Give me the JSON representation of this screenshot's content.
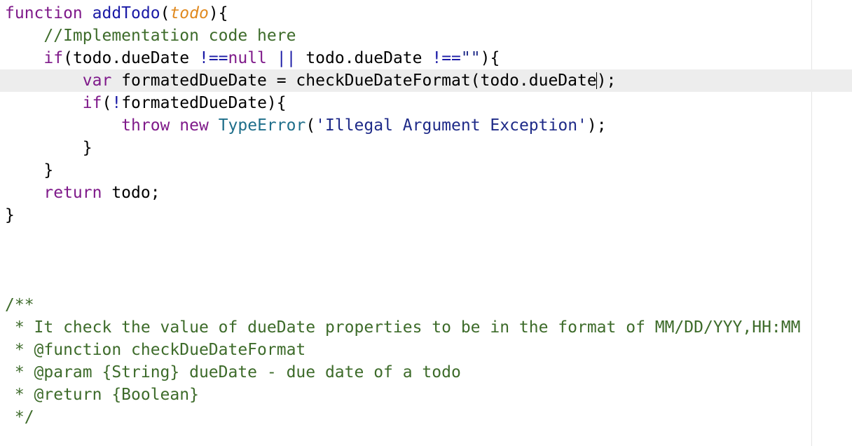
{
  "colors": {
    "keyword": "#7f1a8a",
    "function_name": "#1a1aa6",
    "parameter": "#e0891e",
    "string": "#1e2a88",
    "class": "#1e6e8a",
    "comment": "#3d6b2a",
    "current_line": "#ededed"
  },
  "editor": {
    "lines": [
      [
        {
          "t": "kw",
          "v": "function"
        },
        {
          "t": "",
          "v": " "
        },
        {
          "t": "fn",
          "v": "addTodo"
        },
        {
          "t": "",
          "v": "("
        },
        {
          "t": "param",
          "v": "todo"
        },
        {
          "t": "",
          "v": "){"
        }
      ],
      [
        {
          "t": "",
          "v": "    "
        },
        {
          "t": "cmt",
          "v": "//Implementation code here"
        }
      ],
      [
        {
          "t": "",
          "v": "    "
        },
        {
          "t": "kw",
          "v": "if"
        },
        {
          "t": "",
          "v": "(todo.dueDate "
        },
        {
          "t": "op",
          "v": "!=="
        },
        {
          "t": "kw",
          "v": "null"
        },
        {
          "t": "",
          "v": " "
        },
        {
          "t": "op",
          "v": "||"
        },
        {
          "t": "",
          "v": " todo.dueDate "
        },
        {
          "t": "op",
          "v": "!=="
        },
        {
          "t": "str",
          "v": "\"\""
        },
        {
          "t": "",
          "v": "){"
        }
      ],
      [
        {
          "t": "",
          "v": "        "
        },
        {
          "t": "kw",
          "v": "var"
        },
        {
          "t": "",
          "v": " formatedDueDate = checkDueDateFormat(todo.dueDate"
        },
        {
          "t": "caret",
          "v": ""
        },
        {
          "t": "",
          "v": ");"
        }
      ],
      [
        {
          "t": "",
          "v": "        "
        },
        {
          "t": "kw",
          "v": "if"
        },
        {
          "t": "",
          "v": "("
        },
        {
          "t": "op",
          "v": "!"
        },
        {
          "t": "",
          "v": "formatedDueDate){"
        }
      ],
      [
        {
          "t": "",
          "v": "            "
        },
        {
          "t": "kw",
          "v": "throw"
        },
        {
          "t": "",
          "v": " "
        },
        {
          "t": "kw",
          "v": "new"
        },
        {
          "t": "",
          "v": " "
        },
        {
          "t": "cls",
          "v": "TypeError"
        },
        {
          "t": "",
          "v": "("
        },
        {
          "t": "str",
          "v": "'Illegal Argument Exception'"
        },
        {
          "t": "",
          "v": ");"
        }
      ],
      [
        {
          "t": "",
          "v": "        }"
        }
      ],
      [
        {
          "t": "",
          "v": "    }"
        }
      ],
      [
        {
          "t": "",
          "v": "    "
        },
        {
          "t": "kw",
          "v": "return"
        },
        {
          "t": "",
          "v": " todo;"
        }
      ],
      [
        {
          "t": "",
          "v": "}"
        }
      ],
      [],
      [],
      [],
      [
        {
          "t": "cmt",
          "v": "/**"
        }
      ],
      [
        {
          "t": "cmt",
          "v": " * It check the value of dueDate properties to be in the format of MM/DD/YYY,HH:MM"
        }
      ],
      [
        {
          "t": "cmt",
          "v": " * @function checkDueDateFormat"
        }
      ],
      [
        {
          "t": "cmt",
          "v": " * @param {String} dueDate - due date of a todo"
        }
      ],
      [
        {
          "t": "cmt",
          "v": " * @return {Boolean}"
        }
      ],
      [
        {
          "t": "cmt",
          "v": " */"
        }
      ]
    ],
    "current_line_index": 3
  }
}
